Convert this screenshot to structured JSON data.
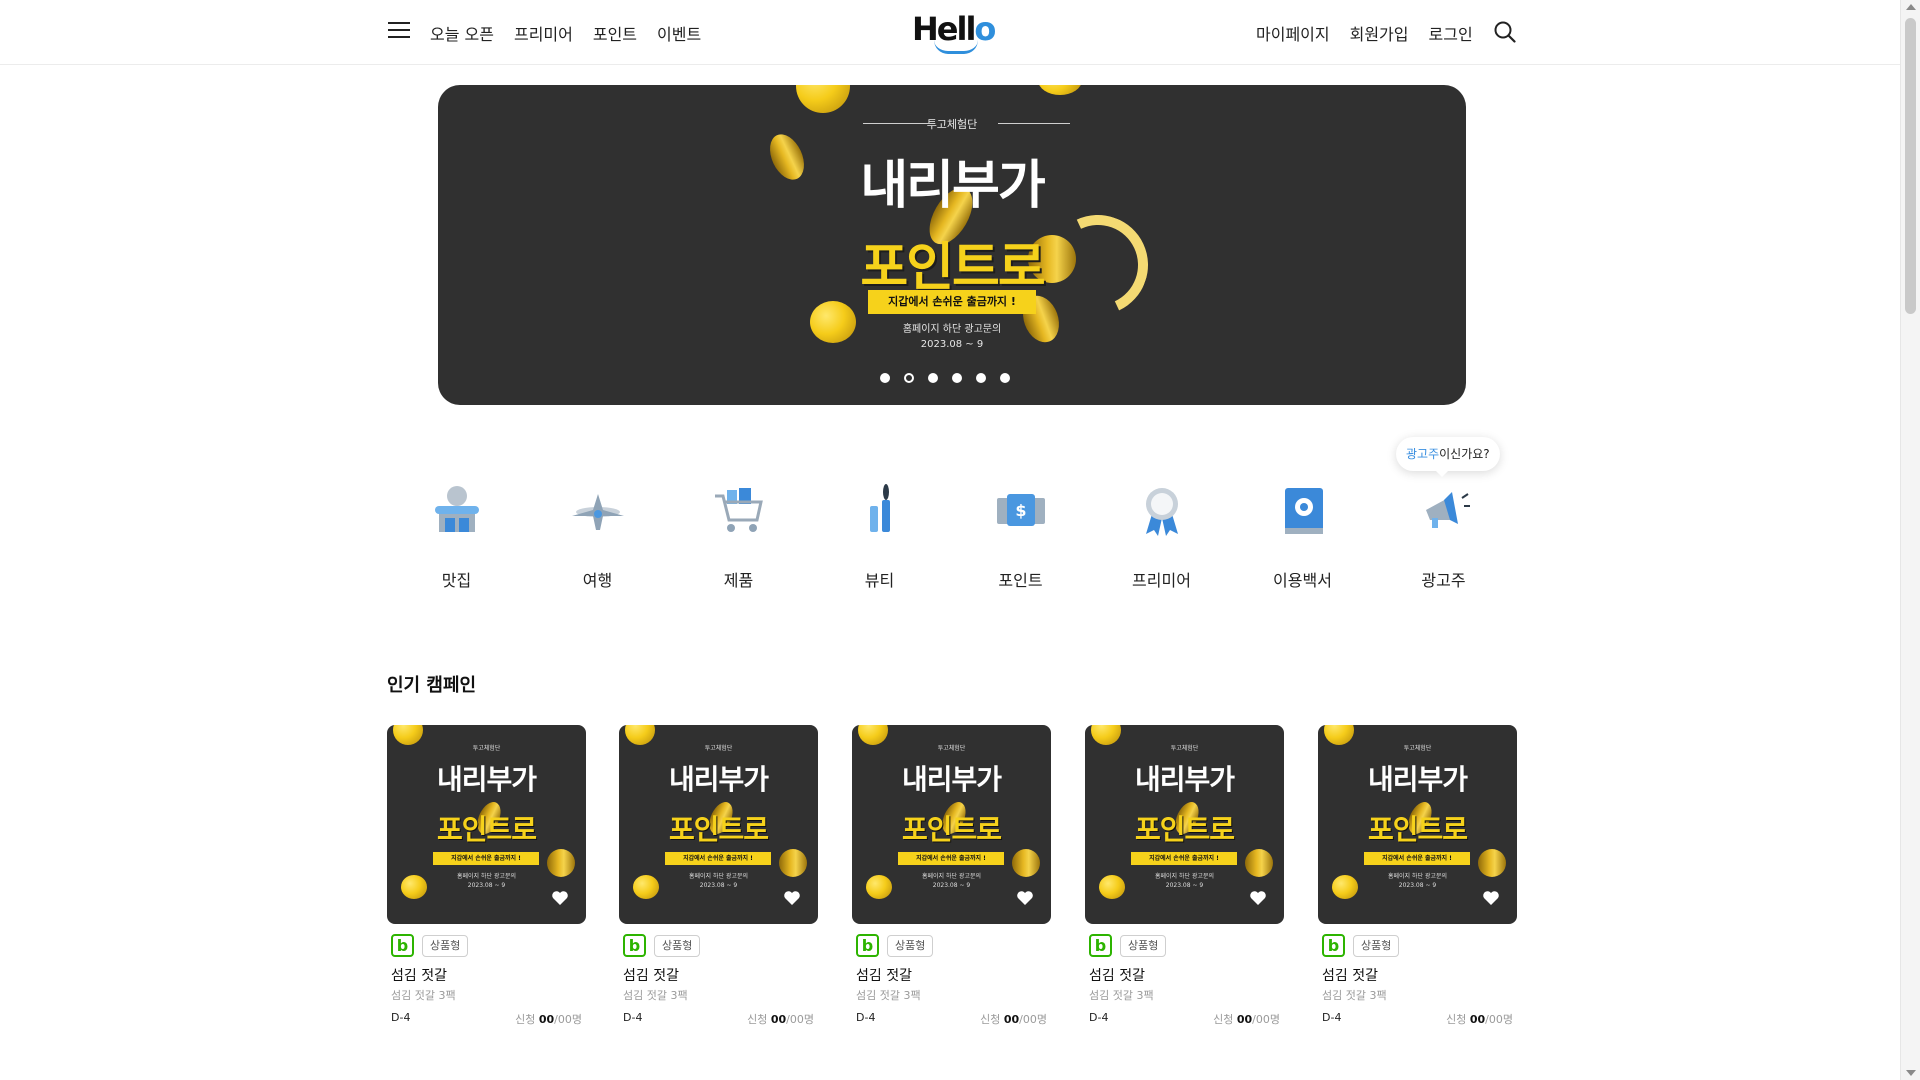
{
  "header": {
    "nav_left": [
      "오늘 오픈",
      "프리미어",
      "포인트",
      "이벤트"
    ],
    "logo": {
      "h": "He",
      "ll": "ll",
      "o": "o"
    },
    "nav_right": [
      "마이페이지",
      "회원가입",
      "로그인"
    ]
  },
  "banner": {
    "kicker": "투고체험단",
    "title_line1": "내리부가",
    "title_line2": "포인트로",
    "pill": "지갑에서 손쉬운 출금까지 !",
    "sub_line1": "홈페이지 하단 광고문의",
    "sub_line2": "2023.08 ~ 9",
    "dots_total": 6,
    "active_dot": 2
  },
  "categories": [
    {
      "label": "맛집",
      "icon": "restaurant-icon"
    },
    {
      "label": "여행",
      "icon": "airplane-icon"
    },
    {
      "label": "제품",
      "icon": "cart-icon"
    },
    {
      "label": "뷰티",
      "icon": "cosmetics-icon"
    },
    {
      "label": "포인트",
      "icon": "money-icon"
    },
    {
      "label": "프리미어",
      "icon": "medal-icon"
    },
    {
      "label": "이용백서",
      "icon": "book-gear-icon"
    },
    {
      "label": "광고주",
      "icon": "megaphone-icon"
    }
  ],
  "tooltip": {
    "accent": "광고주",
    "rest": "이신가요?"
  },
  "popular": {
    "title": "인기 캠페인",
    "cards": [
      {
        "platform": "b",
        "type": "상품형",
        "title": "섬김 젓갈",
        "subtitle": "섬김 젓갈 3팩",
        "dday": "D-4",
        "apply_label": "신청",
        "applied": "00",
        "total": "/00명"
      },
      {
        "platform": "b",
        "type": "상품형",
        "title": "섬김 젓갈",
        "subtitle": "섬김 젓갈 3팩",
        "dday": "D-4",
        "apply_label": "신청",
        "applied": "00",
        "total": "/00명"
      },
      {
        "platform": "b",
        "type": "상품형",
        "title": "섬김 젓갈",
        "subtitle": "섬김 젓갈 3팩",
        "dday": "D-4",
        "apply_label": "신청",
        "applied": "00",
        "total": "/00명"
      },
      {
        "platform": "b",
        "type": "상품형",
        "title": "섬김 젓갈",
        "subtitle": "섬김 젓갈 3팩",
        "dday": "D-4",
        "apply_label": "신청",
        "applied": "00",
        "total": "/00명"
      },
      {
        "platform": "b",
        "type": "상품형",
        "title": "섬김 젓갈",
        "subtitle": "섬김 젓갈 3팩",
        "dday": "D-4",
        "apply_label": "신청",
        "applied": "00",
        "total": "/00명"
      }
    ]
  },
  "colors": {
    "accent_yellow": "#f6d21b",
    "banner_bg": "#303030",
    "logo_blue": "#2f8fdc",
    "naver_green": "#2db400"
  }
}
